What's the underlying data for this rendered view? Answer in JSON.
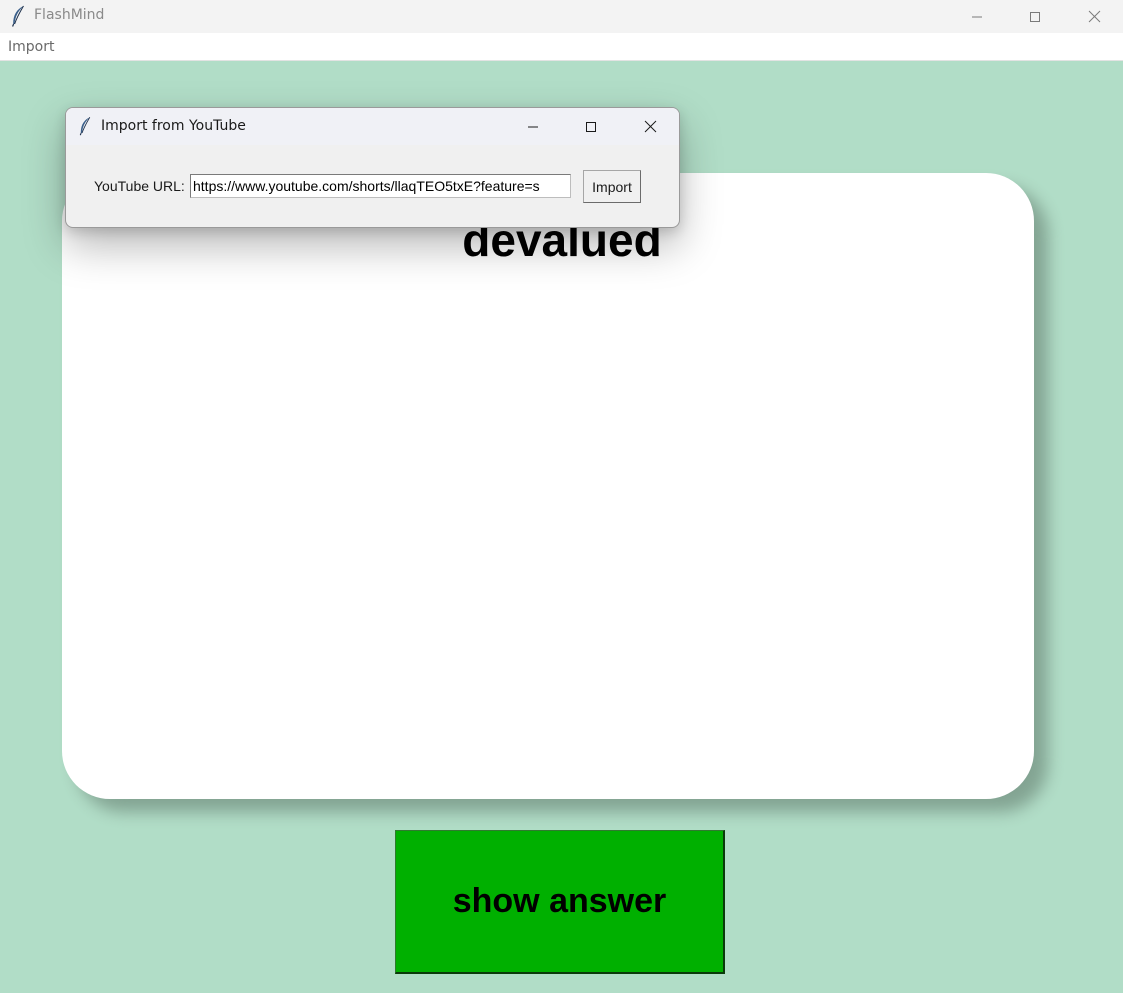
{
  "window": {
    "title": "FlashMind",
    "icon": "feather-icon",
    "controls": [
      "minimize-icon",
      "maximize-icon",
      "close-icon"
    ]
  },
  "menubar": {
    "items": [
      {
        "label": "Import"
      }
    ]
  },
  "card": {
    "word": "devalued"
  },
  "answer_button": {
    "label": "show answer",
    "color": "#00b000"
  },
  "dialog": {
    "title": "Import from YouTube",
    "icon": "feather-icon",
    "url_label": "YouTube URL:",
    "url_value": "https://www.youtube.com/shorts/llaqTEO5txE?feature=s",
    "import_label": "Import"
  },
  "colors": {
    "background": "#b1ddc7",
    "card": "#ffffff",
    "button": "#00b000"
  }
}
